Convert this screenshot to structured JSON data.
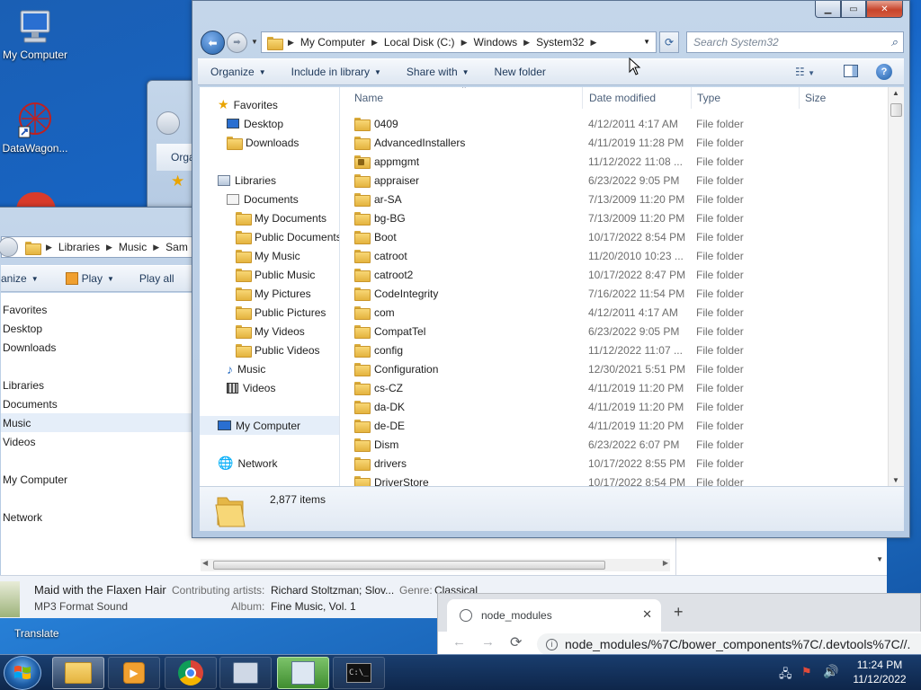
{
  "desktop": {
    "icons": [
      {
        "label": "My Computer",
        "icon": "computer-icon"
      },
      {
        "label": "DataWagon...",
        "icon": "datawagon-icon"
      }
    ]
  },
  "explorer": {
    "address": {
      "crumbs": [
        "My Computer",
        "Local Disk (C:)",
        "Windows",
        "System32"
      ],
      "search_placeholder": "Search System32"
    },
    "toolbar": {
      "organize": "Organize",
      "include": "Include in library",
      "share": "Share with",
      "new_folder": "New folder"
    },
    "nav": {
      "favorites": "Favorites",
      "desktop": "Desktop",
      "downloads": "Downloads",
      "libraries": "Libraries",
      "documents": "Documents",
      "my_documents": "My Documents",
      "public_documents": "Public Documents",
      "my_music": "My Music",
      "public_music": "Public Music",
      "my_pictures": "My Pictures",
      "public_pictures": "Public Pictures",
      "my_videos": "My Videos",
      "public_videos": "Public Videos",
      "music": "Music",
      "videos": "Videos",
      "my_computer": "My Computer",
      "network": "Network"
    },
    "columns": {
      "name": "Name",
      "date": "Date modified",
      "type": "Type",
      "size": "Size"
    },
    "files": [
      {
        "name": "0409",
        "date": "4/12/2011 4:17 AM",
        "type": "File folder",
        "locked": false
      },
      {
        "name": "AdvancedInstallers",
        "date": "4/11/2019 11:28 PM",
        "type": "File folder",
        "locked": false
      },
      {
        "name": "appmgmt",
        "date": "11/12/2022 11:08 ...",
        "type": "File folder",
        "locked": true
      },
      {
        "name": "appraiser",
        "date": "6/23/2022 9:05 PM",
        "type": "File folder",
        "locked": false
      },
      {
        "name": "ar-SA",
        "date": "7/13/2009 11:20 PM",
        "type": "File folder",
        "locked": false
      },
      {
        "name": "bg-BG",
        "date": "7/13/2009 11:20 PM",
        "type": "File folder",
        "locked": false
      },
      {
        "name": "Boot",
        "date": "10/17/2022 8:54 PM",
        "type": "File folder",
        "locked": false
      },
      {
        "name": "catroot",
        "date": "11/20/2010 10:23 ...",
        "type": "File folder",
        "locked": false
      },
      {
        "name": "catroot2",
        "date": "10/17/2022 8:47 PM",
        "type": "File folder",
        "locked": false
      },
      {
        "name": "CodeIntegrity",
        "date": "7/16/2022 11:54 PM",
        "type": "File folder",
        "locked": false
      },
      {
        "name": "com",
        "date": "4/12/2011 4:17 AM",
        "type": "File folder",
        "locked": false
      },
      {
        "name": "CompatTel",
        "date": "6/23/2022 9:05 PM",
        "type": "File folder",
        "locked": false
      },
      {
        "name": "config",
        "date": "11/12/2022 11:07 ...",
        "type": "File folder",
        "locked": false
      },
      {
        "name": "Configuration",
        "date": "12/30/2021 5:51 PM",
        "type": "File folder",
        "locked": false
      },
      {
        "name": "cs-CZ",
        "date": "4/11/2019 11:20 PM",
        "type": "File folder",
        "locked": false
      },
      {
        "name": "da-DK",
        "date": "4/11/2019 11:20 PM",
        "type": "File folder",
        "locked": false
      },
      {
        "name": "de-DE",
        "date": "4/11/2019 11:20 PM",
        "type": "File folder",
        "locked": false
      },
      {
        "name": "Dism",
        "date": "6/23/2022 6:07 PM",
        "type": "File folder",
        "locked": false
      },
      {
        "name": "drivers",
        "date": "10/17/2022 8:55 PM",
        "type": "File folder",
        "locked": false
      },
      {
        "name": "DriverStore",
        "date": "10/17/2022 8:54 PM",
        "type": "File folder",
        "locked": false
      }
    ],
    "details": {
      "count": "2,877 items"
    }
  },
  "music_window": {
    "crumbs": [
      "Libraries",
      "Music",
      "Sam"
    ],
    "toolbar": {
      "organize": "anize",
      "play": "Play",
      "play_all": "Play all"
    },
    "nav": {
      "favorites": "Favorites",
      "desktop": "Desktop",
      "downloads": "Downloads",
      "libraries": "Libraries",
      "documents": "Documents",
      "music": "Music",
      "videos": "Videos",
      "my_computer": "My Computer",
      "network": "Network"
    },
    "track": {
      "title": "Maid with the Flaxen Hair",
      "format": "MP3 Format Sound",
      "artists_label": "Contributing artists:",
      "artists": "Richard Stoltzman; Slov...",
      "genre_label": "Genre:",
      "genre": "Classical",
      "album_label": "Album:",
      "album": "Fine Music, Vol. 1"
    }
  },
  "back_window": {
    "organize": "Orga"
  },
  "chrome_popup": {
    "tab_title": "node_modules",
    "url": "node_modules/%7C/bower_components%7C/.devtools%7C//."
  },
  "desktop_misc": {
    "translate": "Translate"
  },
  "taskbar": {
    "time": "11:24 PM",
    "date": "11/12/2022"
  },
  "colors": {
    "accent": "#1f5fa8",
    "folder": "#f2cc63",
    "close": "#c7442b"
  }
}
